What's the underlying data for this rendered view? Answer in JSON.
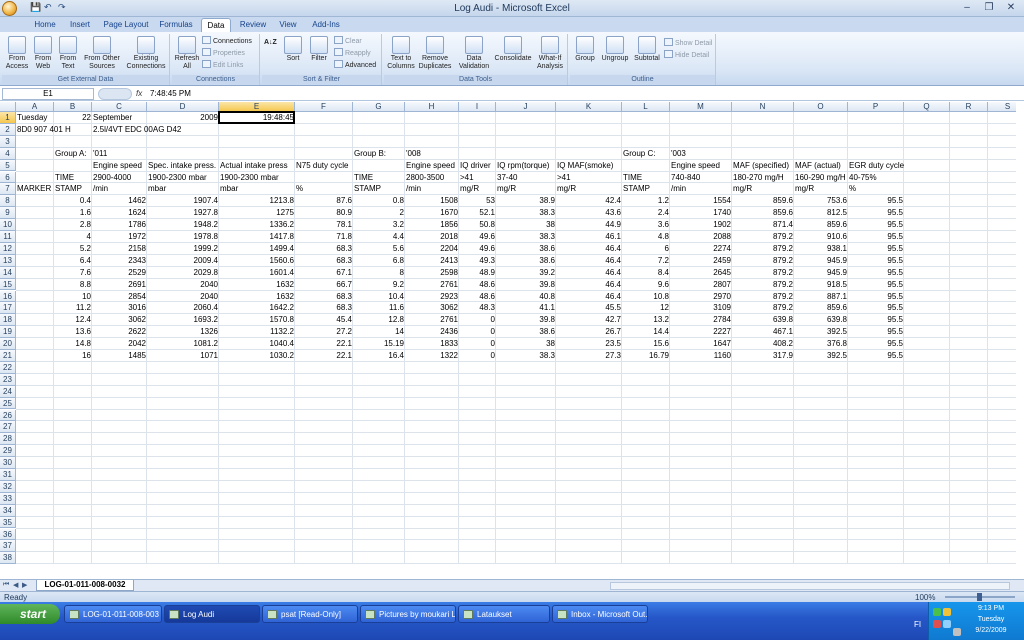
{
  "window": {
    "title": "Log Audi - Microsoft Excel"
  },
  "ribbon_tabs": [
    "Home",
    "Insert",
    "Page Layout",
    "Formulas",
    "Data",
    "Review",
    "View",
    "Add-Ins"
  ],
  "ribbon": {
    "groups": [
      "Get External Data",
      "Connections",
      "Sort & Filter",
      "Data Tools",
      "Outline"
    ],
    "buttons": {
      "from_access": "From Access",
      "from_web": "From Web",
      "from_text": "From Text",
      "from_other": "From Other Sources",
      "existing": "Existing Connections",
      "refresh": "Refresh All",
      "connections": "Connections",
      "properties": "Properties",
      "edit_links": "Edit Links",
      "sort_az": "A↓Z",
      "sort": "Sort",
      "filter": "Filter",
      "clear": "Clear",
      "reapply": "Reapply",
      "advanced": "Advanced",
      "text_to_columns": "Text to Columns",
      "remove_duplicates": "Remove Duplicates",
      "data_validation": "Data Validation",
      "consolidate": "Consolidate",
      "what_if": "What-If Analysis",
      "group": "Group",
      "ungroup": "Ungroup",
      "subtotal": "Subtotal",
      "show_detail": "Show Detail",
      "hide_detail": "Hide Detail"
    }
  },
  "formula_bar": {
    "name_box": "E1",
    "fx": "fx",
    "value": "7:48:45 PM"
  },
  "columns": [
    "A",
    "B",
    "C",
    "D",
    "E",
    "F",
    "G",
    "H",
    "I",
    "J",
    "K",
    "L",
    "M",
    "N",
    "O",
    "P",
    "Q",
    "R",
    "S"
  ],
  "selected_column": "E",
  "selected_row": 1,
  "row_count": 38,
  "cells": [
    {
      "r": 1,
      "c": "A",
      "v": "Tuesday"
    },
    {
      "r": 1,
      "c": "B",
      "v": "22",
      "num": true
    },
    {
      "r": 1,
      "c": "C",
      "v": "September"
    },
    {
      "r": 1,
      "c": "D",
      "v": "2009",
      "num": true
    },
    {
      "r": 1,
      "c": "E",
      "v": "19:48:45",
      "num": true
    },
    {
      "r": 2,
      "c": "A",
      "v": "8D0 907 401 H"
    },
    {
      "r": 2,
      "c": "C",
      "v": "2.5l/4VT EDC  00AG  D42"
    },
    {
      "r": 4,
      "c": "B",
      "v": "Group A:"
    },
    {
      "r": 4,
      "c": "C",
      "v": "'011"
    },
    {
      "r": 4,
      "c": "G",
      "v": "Group B:"
    },
    {
      "r": 4,
      "c": "H",
      "v": "'008"
    },
    {
      "r": 4,
      "c": "L",
      "v": "Group C:"
    },
    {
      "r": 4,
      "c": "M",
      "v": "'003"
    },
    {
      "r": 5,
      "c": "C",
      "v": "Engine speed"
    },
    {
      "r": 5,
      "c": "D",
      "v": "Spec. intake press."
    },
    {
      "r": 5,
      "c": "E",
      "v": "Actual intake press"
    },
    {
      "r": 5,
      "c": "F",
      "v": "N75 duty cycle"
    },
    {
      "r": 5,
      "c": "H",
      "v": "Engine speed"
    },
    {
      "r": 5,
      "c": "I",
      "v": "IQ driver"
    },
    {
      "r": 5,
      "c": "J",
      "v": "IQ rpm(torque)"
    },
    {
      "r": 5,
      "c": "K",
      "v": "IQ MAF(smoke)"
    },
    {
      "r": 5,
      "c": "M",
      "v": "Engine speed"
    },
    {
      "r": 5,
      "c": "N",
      "v": "MAF (specified)"
    },
    {
      "r": 5,
      "c": "O",
      "v": "MAF (actual)"
    },
    {
      "r": 5,
      "c": "P",
      "v": "EGR duty cycle"
    },
    {
      "r": 6,
      "c": "B",
      "v": "TIME"
    },
    {
      "r": 6,
      "c": "C",
      "v": "2900-4000"
    },
    {
      "r": 6,
      "c": "D",
      "v": "1900-2300 mbar"
    },
    {
      "r": 6,
      "c": "E",
      "v": "1900-2300 mbar"
    },
    {
      "r": 6,
      "c": "G",
      "v": "TIME"
    },
    {
      "r": 6,
      "c": "H",
      "v": "2800-3500"
    },
    {
      "r": 6,
      "c": "I",
      "v": ">41"
    },
    {
      "r": 6,
      "c": "J",
      "v": "37-40"
    },
    {
      "r": 6,
      "c": "K",
      "v": ">41"
    },
    {
      "r": 6,
      "c": "L",
      "v": "TIME"
    },
    {
      "r": 6,
      "c": "M",
      "v": "740-840"
    },
    {
      "r": 6,
      "c": "N",
      "v": "180-270 mg/H"
    },
    {
      "r": 6,
      "c": "O",
      "v": "160-290 mg/H"
    },
    {
      "r": 6,
      "c": "P",
      "v": "40-75%"
    },
    {
      "r": 7,
      "c": "A",
      "v": "MARKER"
    },
    {
      "r": 7,
      "c": "B",
      "v": "STAMP"
    },
    {
      "r": 7,
      "c": "C",
      "v": "/min"
    },
    {
      "r": 7,
      "c": "D",
      "v": "mbar"
    },
    {
      "r": 7,
      "c": "E",
      "v": "mbar"
    },
    {
      "r": 7,
      "c": "F",
      "v": "%"
    },
    {
      "r": 7,
      "c": "G",
      "v": "STAMP"
    },
    {
      "r": 7,
      "c": "H",
      "v": "/min"
    },
    {
      "r": 7,
      "c": "I",
      "v": "mg/R"
    },
    {
      "r": 7,
      "c": "J",
      "v": "mg/R"
    },
    {
      "r": 7,
      "c": "K",
      "v": "mg/R"
    },
    {
      "r": 7,
      "c": "L",
      "v": "STAMP"
    },
    {
      "r": 7,
      "c": "M",
      "v": "/min"
    },
    {
      "r": 7,
      "c": "N",
      "v": "mg/R"
    },
    {
      "r": 7,
      "c": "O",
      "v": "mg/R"
    },
    {
      "r": 7,
      "c": "P",
      "v": "%"
    }
  ],
  "data_rows": [
    [
      "0.4",
      "1462",
      "1907.4",
      "1213.8",
      "87.6",
      "0.8",
      "1508",
      "53",
      "38.9",
      "42.4",
      "1.2",
      "1554",
      "859.6",
      "753.6",
      "95.5"
    ],
    [
      "1.6",
      "1624",
      "1927.8",
      "1275",
      "80.9",
      "2",
      "1670",
      "52.1",
      "38.3",
      "43.6",
      "2.4",
      "1740",
      "859.6",
      "812.5",
      "95.5"
    ],
    [
      "2.8",
      "1786",
      "1948.2",
      "1336.2",
      "78.1",
      "3.2",
      "1856",
      "50.8",
      "38",
      "44.9",
      "3.6",
      "1902",
      "871.4",
      "859.6",
      "95.5"
    ],
    [
      "4",
      "1972",
      "1978.8",
      "1417.8",
      "71.8",
      "4.4",
      "2018",
      "49.6",
      "38.3",
      "46.1",
      "4.8",
      "2088",
      "879.2",
      "910.6",
      "95.5"
    ],
    [
      "5.2",
      "2158",
      "1999.2",
      "1499.4",
      "68.3",
      "5.6",
      "2204",
      "49.6",
      "38.6",
      "46.4",
      "6",
      "2274",
      "879.2",
      "938.1",
      "95.5"
    ],
    [
      "6.4",
      "2343",
      "2009.4",
      "1560.6",
      "68.3",
      "6.8",
      "2413",
      "49.3",
      "38.6",
      "46.4",
      "7.2",
      "2459",
      "879.2",
      "945.9",
      "95.5"
    ],
    [
      "7.6",
      "2529",
      "2029.8",
      "1601.4",
      "67.1",
      "8",
      "2598",
      "48.9",
      "39.2",
      "46.4",
      "8.4",
      "2645",
      "879.2",
      "945.9",
      "95.5"
    ],
    [
      "8.8",
      "2691",
      "2040",
      "1632",
      "66.7",
      "9.2",
      "2761",
      "48.6",
      "39.8",
      "46.4",
      "9.6",
      "2807",
      "879.2",
      "918.5",
      "95.5"
    ],
    [
      "10",
      "2854",
      "2040",
      "1632",
      "68.3",
      "10.4",
      "2923",
      "48.6",
      "40.8",
      "46.4",
      "10.8",
      "2970",
      "879.2",
      "887.1",
      "95.5"
    ],
    [
      "11.2",
      "3016",
      "2060.4",
      "1642.2",
      "68.3",
      "11.6",
      "3062",
      "48.3",
      "41.1",
      "45.5",
      "12",
      "3109",
      "879.2",
      "859.6",
      "95.5"
    ],
    [
      "12.4",
      "3062",
      "1693.2",
      "1570.8",
      "45.4",
      "12.8",
      "2761",
      "0",
      "39.8",
      "42.7",
      "13.2",
      "2784",
      "639.8",
      "639.8",
      "95.5"
    ],
    [
      "13.6",
      "2622",
      "1326",
      "1132.2",
      "27.2",
      "14",
      "2436",
      "0",
      "38.6",
      "26.7",
      "14.4",
      "2227",
      "467.1",
      "392.5",
      "95.5"
    ],
    [
      "14.8",
      "2042",
      "1081.2",
      "1040.4",
      "22.1",
      "15.19",
      "1833",
      "0",
      "38",
      "23.5",
      "15.6",
      "1647",
      "408.2",
      "376.8",
      "95.5"
    ],
    [
      "16",
      "1485",
      "1071",
      "1030.2",
      "22.1",
      "16.4",
      "1322",
      "0",
      "38.3",
      "27.3",
      "16.79",
      "1160",
      "317.9",
      "392.5",
      "95.5"
    ]
  ],
  "sheet_tab": "LOG-01-011-008-0032",
  "status": {
    "ready": "Ready",
    "zoom": "100%"
  },
  "taskbar": {
    "start": "start",
    "tasks": [
      "LOG-01-011-008-003",
      "Log Audi",
      "psat  [Read-Only]",
      "Pictures by moukari L...",
      "Lataukset",
      "Inbox - Microsoft Out..."
    ],
    "clock": {
      "time": "9:13 PM",
      "day": "Tuesday",
      "date": "9/22/2009"
    },
    "lang": "FI"
  }
}
